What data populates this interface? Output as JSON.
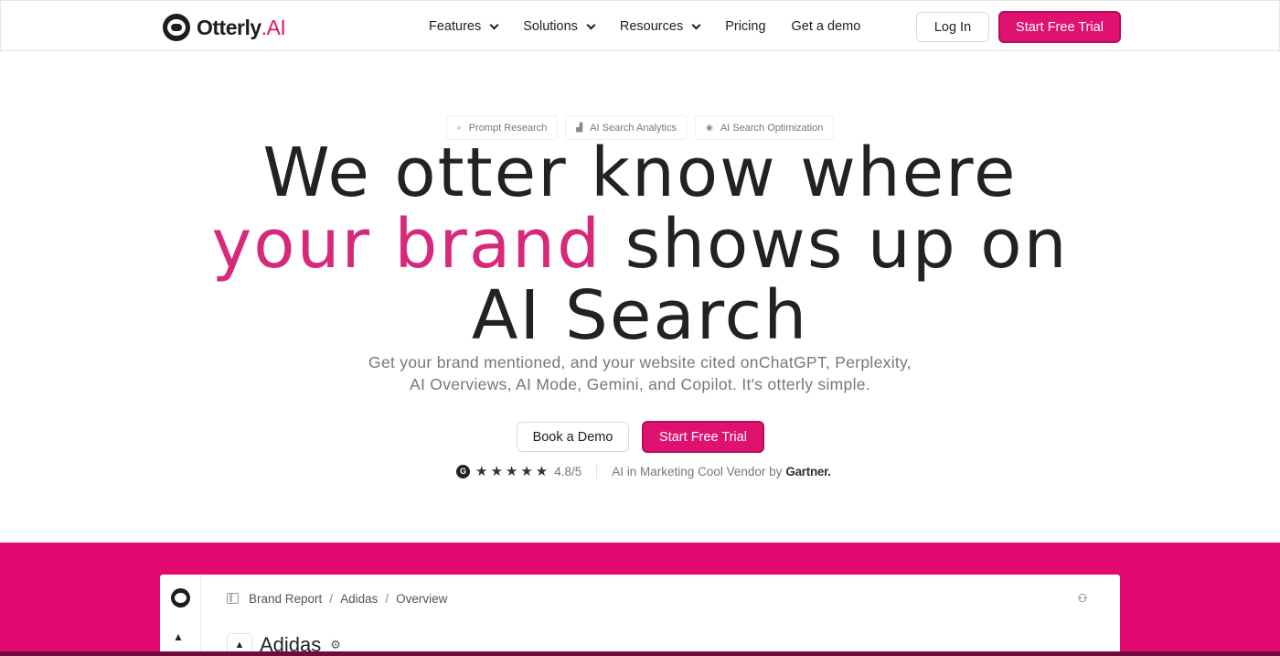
{
  "nav": {
    "logo_text": "Otterly",
    "logo_suffix": ".AI",
    "links": [
      {
        "label": "Features"
      },
      {
        "label": "Solutions"
      },
      {
        "label": "Resources"
      },
      {
        "label": "Pricing"
      },
      {
        "label": "Get a demo"
      }
    ],
    "login_label": "Log In",
    "trial_label": "Start Free Trial"
  },
  "pills": [
    {
      "icon": "search-icon",
      "label": "Prompt Research"
    },
    {
      "icon": "chart-icon",
      "label": "AI Search Analytics"
    },
    {
      "icon": "target-icon",
      "label": "AI Search Optimization"
    }
  ],
  "hero": {
    "line1": "We otter know where",
    "line2_highlight": "your brand",
    "line2_rest": " shows up on",
    "line3": "AI Search",
    "subtitle": "Get your brand mentioned, and your website cited onChatGPT, Perplexity, AI Overviews, AI Mode, Gemini, and Copilot. It's otterly simple.",
    "demo_label": "Book a Demo",
    "trial_label": "Start Free Trial",
    "highlight_color": "#d8287a"
  },
  "rating": {
    "g2_badge": "G",
    "stars": "★★★★★",
    "score": "4.8/5",
    "vendor_text": "AI in Marketing Cool Vendor by",
    "vendor_brand": "Gartner."
  },
  "preview": {
    "breadcrumb": [
      "Brand Report",
      "Adidas",
      "Overview"
    ],
    "crumb_separator": "/",
    "page_title": "Adidas",
    "brand_icon": "adidas-logo-icon"
  },
  "colors": {
    "accent": "#e0126f",
    "band": "#e20a70",
    "text": "#222222",
    "muted": "#777777"
  }
}
